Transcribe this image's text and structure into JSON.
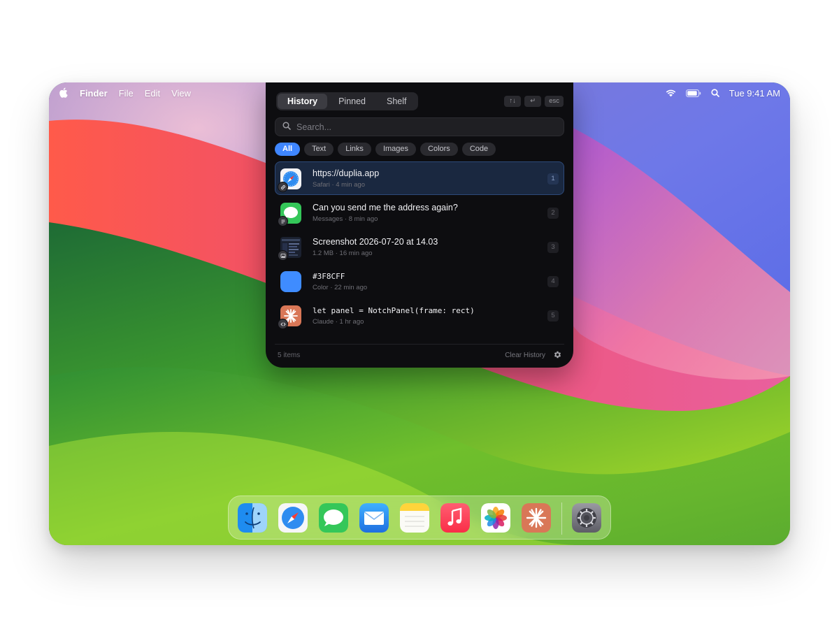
{
  "menubar": {
    "app_name": "Finder",
    "menus": [
      "File",
      "Edit",
      "View"
    ],
    "clock": "Tue 9:41 AM"
  },
  "panel": {
    "tabs": [
      {
        "label": "History",
        "active": true
      },
      {
        "label": "Pinned",
        "active": false
      },
      {
        "label": "Shelf",
        "active": false
      }
    ],
    "shortcuts": [
      "↑↓",
      "↵",
      "esc"
    ],
    "search": {
      "placeholder": "Search...",
      "value": ""
    },
    "filters": [
      {
        "label": "All",
        "active": true
      },
      {
        "label": "Text",
        "active": false
      },
      {
        "label": "Links",
        "active": false
      },
      {
        "label": "Images",
        "active": false
      },
      {
        "label": "Colors",
        "active": false
      },
      {
        "label": "Code",
        "active": false
      }
    ],
    "items": [
      {
        "title": "https://duplia.app",
        "meta": "Safari · 4 min ago",
        "index": "1",
        "kind": "link",
        "icon": "safari-icon",
        "selected": true
      },
      {
        "title": "Can you send me the address again?",
        "meta": "Messages · 8 min ago",
        "index": "2",
        "kind": "text",
        "icon": "messages-icon",
        "selected": false
      },
      {
        "title": "Screenshot 2026-07-20 at 14.03",
        "meta": "1.2 MB · 16 min ago",
        "index": "3",
        "kind": "image",
        "icon": "screenshot-thumbnail",
        "selected": false
      },
      {
        "title": "#3F8CFF",
        "meta": "Color · 22 min ago",
        "index": "4",
        "kind": "color",
        "icon": "color-swatch",
        "color": "#3F8CFF",
        "selected": false
      },
      {
        "title": "let panel = NotchPanel(frame: rect)",
        "meta": "Claude · 1 hr ago",
        "index": "5",
        "kind": "code",
        "icon": "claude-icon",
        "selected": false
      }
    ],
    "footer": {
      "count": "5 items",
      "clear_label": "Clear History"
    }
  },
  "dock": {
    "apps": [
      "finder-icon",
      "safari-icon",
      "messages-icon",
      "mail-icon",
      "notes-icon",
      "music-icon",
      "photos-icon",
      "claude-icon",
      "system-settings-icon"
    ]
  },
  "colors": {
    "accent": "#3F8CFF",
    "panel_bg": "#0D0D10",
    "selected_row": "#1A2840"
  }
}
